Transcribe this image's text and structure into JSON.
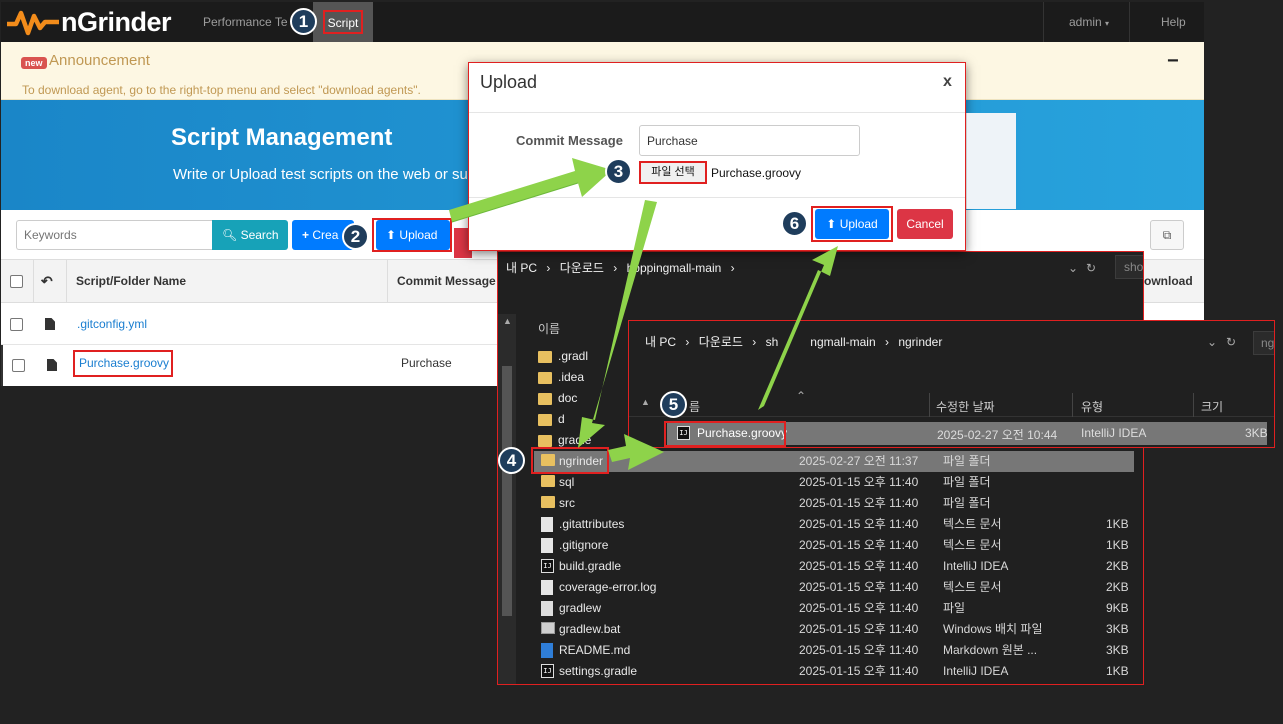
{
  "navbar": {
    "brand": "nGrinder",
    "items": [
      "Performance Te",
      "Script"
    ],
    "user": "admin",
    "help": "Help"
  },
  "announcement": {
    "badge": "new",
    "title": "Announcement",
    "text": "To download agent, go to the right-top menu and select \"download agents\".",
    "toggle": "−"
  },
  "hero": {
    "title": "Script Management",
    "subtitle": "Write or Upload test scripts on the web or su"
  },
  "toolbar": {
    "keyword_placeholder": "Keywords",
    "search": "Search",
    "create": "Crea",
    "upload": "Upload"
  },
  "table": {
    "headers": [
      "Script/Folder Name",
      "Commit Message",
      "ownload"
    ],
    "rows": [
      {
        "name": ".gitconfig.yml",
        "commit": ""
      },
      {
        "name": "Purchase.groovy",
        "commit": "Purchase"
      }
    ]
  },
  "modal": {
    "title": "Upload",
    "close": "x",
    "commit_label": "Commit Message",
    "commit_value": "Purchase",
    "file_button": "파일 선택",
    "file_name": "Purchase.groovy",
    "upload": "Upload",
    "cancel": "Cancel"
  },
  "explorer1": {
    "path": [
      "내 PC",
      "다운로드",
      "hoppingmall-main"
    ],
    "search_placeholder": "sho",
    "name_header": "이름",
    "tree": [
      ".gradl",
      ".idea",
      "doc",
      "d",
      "gradle"
    ],
    "files": [
      {
        "name": "ngrinder",
        "date": "2025-02-27 오전 11:37",
        "type": "파일 폴더",
        "size": "",
        "icon": "folder-icon"
      },
      {
        "name": "sql",
        "date": "2025-01-15 오후 11:40",
        "type": "파일 폴더",
        "size": "",
        "icon": "folder-icon"
      },
      {
        "name": "src",
        "date": "2025-01-15 오후 11:40",
        "type": "파일 폴더",
        "size": "",
        "icon": "folder-icon"
      },
      {
        "name": ".gitattributes",
        "date": "2025-01-15 오후 11:40",
        "type": "텍스트 문서",
        "size": "1KB",
        "icon": "text-file-icon"
      },
      {
        "name": ".gitignore",
        "date": "2025-01-15 오후 11:40",
        "type": "텍스트 문서",
        "size": "1KB",
        "icon": "text-file-icon"
      },
      {
        "name": "build.gradle",
        "date": "2025-01-15 오후 11:40",
        "type": "IntelliJ IDEA",
        "size": "2KB",
        "icon": "intellij-file-icon"
      },
      {
        "name": "coverage-error.log",
        "date": "2025-01-15 오후 11:40",
        "type": "텍스트 문서",
        "size": "2KB",
        "icon": "text-file-icon"
      },
      {
        "name": "gradlew",
        "date": "2025-01-15 오후 11:40",
        "type": "파일",
        "size": "9KB",
        "icon": "file-icon"
      },
      {
        "name": "gradlew.bat",
        "date": "2025-01-15 오후 11:40",
        "type": "Windows 배치 파일",
        "size": "3KB",
        "icon": "batch-file-icon"
      },
      {
        "name": "README.md",
        "date": "2025-01-15 오후 11:40",
        "type": "Markdown 원본 ...",
        "size": "3KB",
        "icon": "markdown-file-icon"
      },
      {
        "name": "settings.gradle",
        "date": "2025-01-15 오후 11:40",
        "type": "IntelliJ IDEA",
        "size": "1KB",
        "icon": "intellij-file-icon"
      }
    ]
  },
  "explorer2": {
    "path": [
      "내 PC",
      "다운로드",
      "sh",
      "ngmall-main",
      "ngrinder"
    ],
    "search_placeholder": "ng",
    "headers": [
      "름",
      "수정한 날짜",
      "유형",
      "크기"
    ],
    "file": {
      "name": "Purchase.groovy",
      "date": "2025-02-27 오전 10:44",
      "type": "IntelliJ IDEA",
      "size": "3KB"
    }
  },
  "steps": [
    "1",
    "2",
    "3",
    "4",
    "5",
    "6"
  ],
  "colors": {
    "accent_blue": "#007bff",
    "danger_red": "#dc3545",
    "info_teal": "#17a2b8",
    "annotation_red": "#e02020",
    "arrow_green": "#8ed34a",
    "step_badge": "#1f3d5c"
  }
}
